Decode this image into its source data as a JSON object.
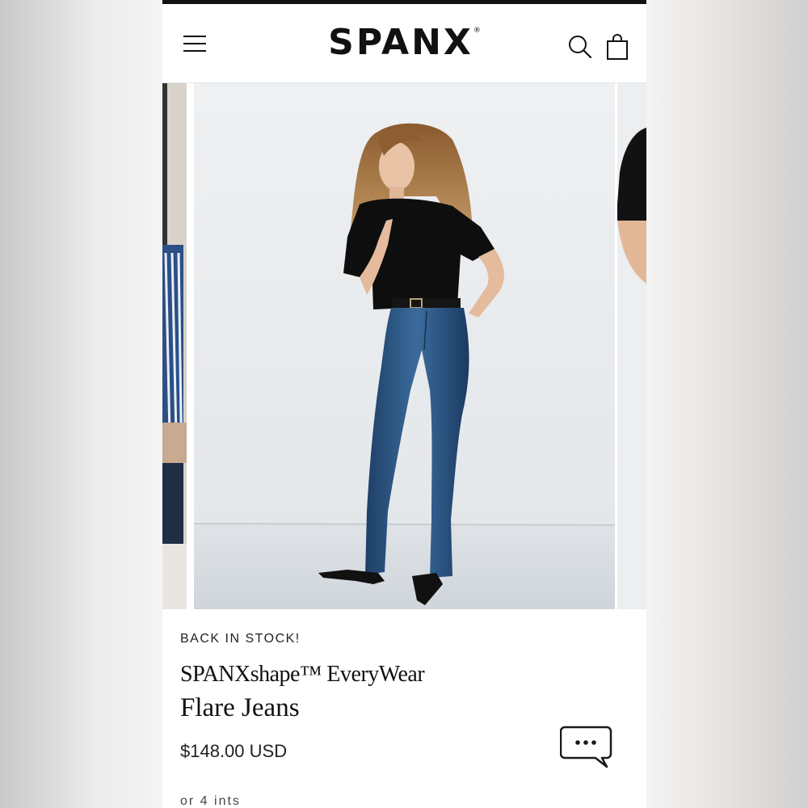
{
  "header": {
    "brand": "SPANX",
    "trademark": "®",
    "icons": [
      "hamburger-menu-icon",
      "search-icon",
      "shopping-bag-icon"
    ]
  },
  "carousel": {
    "slides": [
      {
        "role": "previous",
        "description_icon": "product-photo"
      },
      {
        "role": "current",
        "description_icon": "product-photo"
      },
      {
        "role": "next",
        "description_icon": "product-photo"
      }
    ]
  },
  "product": {
    "badge": "BACK IN STOCK!",
    "name_line1": "SPANXshape™ EveryWear",
    "name_line2": "Flare Jeans",
    "price": "$148.00 USD",
    "cut_off_text": "or 4 ints"
  },
  "chat": {
    "icon": "chat-bubble-icon"
  },
  "colors": {
    "text": "#111111",
    "denim": "#2f5d8c",
    "background": "#ffffff"
  }
}
